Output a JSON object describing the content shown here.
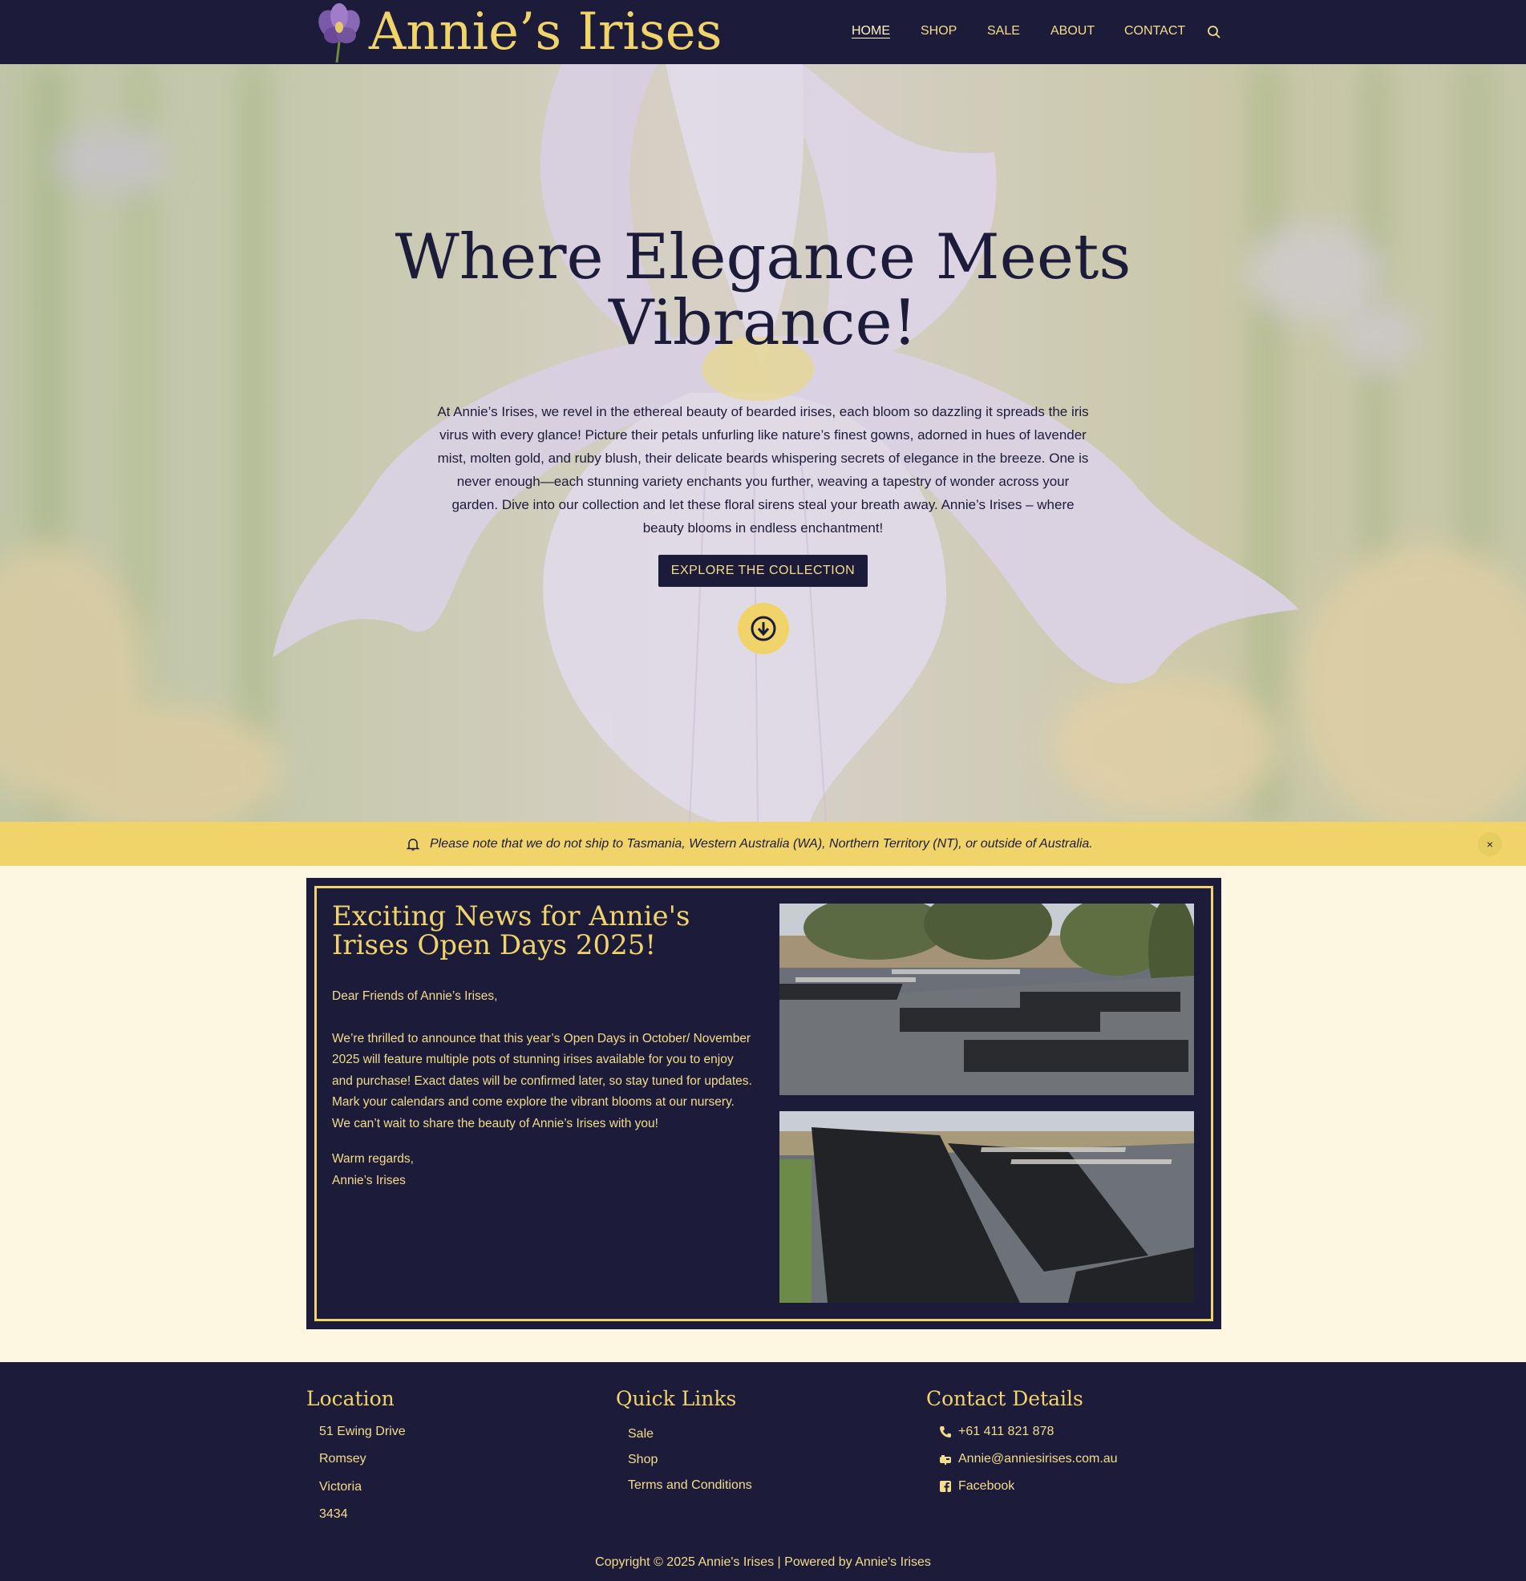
{
  "header": {
    "logo_text": "Annie’s Irises",
    "nav": [
      "HOME",
      "SHOP",
      "SALE",
      "ABOUT",
      "CONTACT"
    ],
    "search_icon": "search-icon"
  },
  "hero": {
    "title_line1": "Where Elegance Meets",
    "title_line2": "Vibrance!",
    "text": "At Annie’s Irises, we revel in the ethereal beauty of bearded irises, each bloom so dazzling it spreads the iris virus with every glance! Picture their petals unfurling like nature’s finest gowns, adorned in hues of lavender mist, molten gold, and ruby blush, their delicate beards whispering secrets of elegance in the breeze. One is never enough—each stunning variety enchants you further, weaving a tapestry of wonder across your garden. Dive into our collection and let these floral sirens steal your breath away. Annie’s Irises – where beauty blooms in endless enchantment!",
    "button": "EXPLORE THE COLLECTION",
    "scroll_icon": "arrow-down-circle-icon"
  },
  "notice": {
    "icon": "bell-icon",
    "text": "Please note that we do not ship to Tasmania, Western Australia (WA), Northern Territory (NT), or outside of Australia.",
    "close": "×"
  },
  "news": {
    "title": "Exciting News for Annie's Irises Open Days 2025!",
    "greeting": "Dear Friends of Annie’s Irises,",
    "paragraph": "We’re thrilled to announce that this year’s Open Days in October/ November 2025 will feature multiple pots of stunning irises available for you to enjoy and purchase! Exact dates will be confirmed later, so stay tuned for updates. Mark your calendars and come explore the vibrant blooms at our nursery.",
    "closing_line": "We can’t wait to share the beauty of Annie’s Irises with you!",
    "regards": "Warm regards,",
    "signature": "Annie’s Irises"
  },
  "footer": {
    "location": {
      "heading": "Location",
      "lines": [
        "51 Ewing Drive",
        "Romsey",
        "Victoria",
        "3434"
      ]
    },
    "quick_links": {
      "heading": "Quick Links",
      "links": [
        "Sale",
        "Shop",
        "Terms and Conditions"
      ]
    },
    "contact": {
      "heading": "Contact Details",
      "phone": "+61 411 821 878",
      "email": "Annie@anniesirises.com.au",
      "facebook": "Facebook"
    },
    "copyright": "Copyright © 2025 Annie's Irises | Powered by Annie's Irises"
  },
  "colors": {
    "navy": "#1d1b3a",
    "gold": "#f0d46a",
    "cream": "#fdf7e1"
  }
}
